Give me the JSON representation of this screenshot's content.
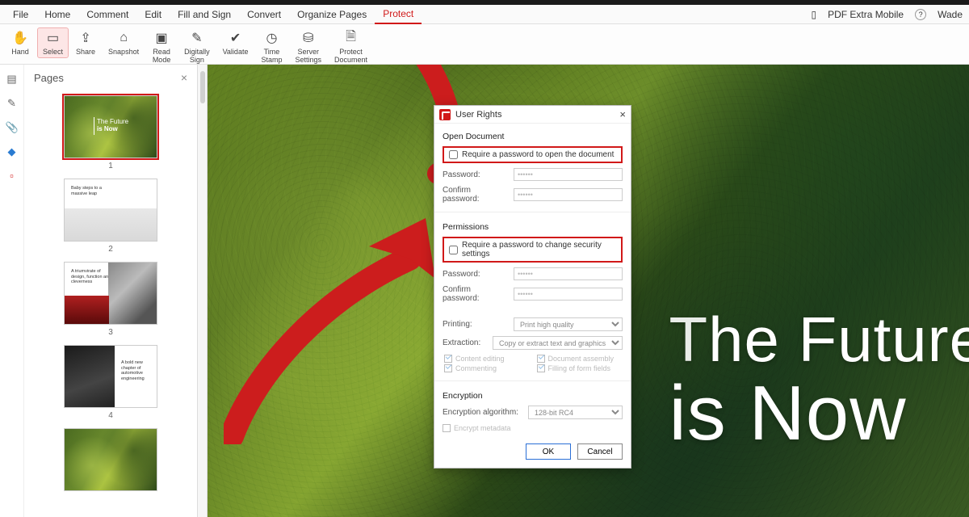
{
  "menu": {
    "tabs": [
      "File",
      "Home",
      "Comment",
      "Edit",
      "Fill and Sign",
      "Convert",
      "Organize Pages",
      "Protect"
    ],
    "active_index": 7,
    "mobile_label": "PDF Extra Mobile",
    "user_label": "Wade"
  },
  "ribbon": {
    "tools": [
      {
        "label": "Hand",
        "icon": "✋"
      },
      {
        "label": "Select",
        "icon": "⬚",
        "selected": true
      },
      {
        "label": "Share",
        "icon": "↗"
      },
      {
        "label": "Snapshot",
        "icon": "📷"
      },
      {
        "label": "Read Mode",
        "icon": "▭",
        "twoLine": "Read\nMode"
      },
      {
        "label": "Digitally Sign",
        "icon": "✒",
        "twoLine": "Digitally\nSign"
      },
      {
        "label": "Validate",
        "icon": "✔"
      },
      {
        "label": "Time Stamp",
        "icon": "🕘",
        "twoLine": "Time\nStamp"
      },
      {
        "label": "Server Settings",
        "icon": "⚙",
        "twoLine": "Server\nSettings"
      },
      {
        "label": "Protect Document",
        "icon": "🔒",
        "twoLine": "Protect\nDocument"
      }
    ]
  },
  "sidebar": {
    "title": "Pages",
    "thumbs": [
      {
        "num": "1",
        "caption_a": "The Future",
        "caption_b": "is Now"
      },
      {
        "num": "2",
        "caption": "Baby steps to a massive leap"
      },
      {
        "num": "3",
        "caption": "A triumvirate of design, function and cleverness"
      },
      {
        "num": "4",
        "caption": "A bold new chapter of automotive engineering"
      }
    ]
  },
  "doc": {
    "title_line1": "The Future",
    "title_line2": "is Now"
  },
  "dialog": {
    "title": "User Rights",
    "open_section": "Open Document",
    "open_checkbox": "Require a password to open the document",
    "password_label": "Password:",
    "confirm_label": "Confirm password:",
    "permissions_section": "Permissions",
    "perm_checkbox": "Require a password to change security settings",
    "printing_label": "Printing:",
    "printing_value": "Print high quality",
    "extraction_label": "Extraction:",
    "extraction_value": "Copy or extract text and graphics",
    "perm_opts": [
      "Content editing",
      "Document assembly",
      "Commenting",
      "Filling of form fields"
    ],
    "encryption_section": "Encryption",
    "enc_alg_label": "Encryption algorithm:",
    "enc_alg_value": "128-bit RC4",
    "enc_meta": "Encrypt metadata",
    "ok": "OK",
    "cancel": "Cancel"
  }
}
